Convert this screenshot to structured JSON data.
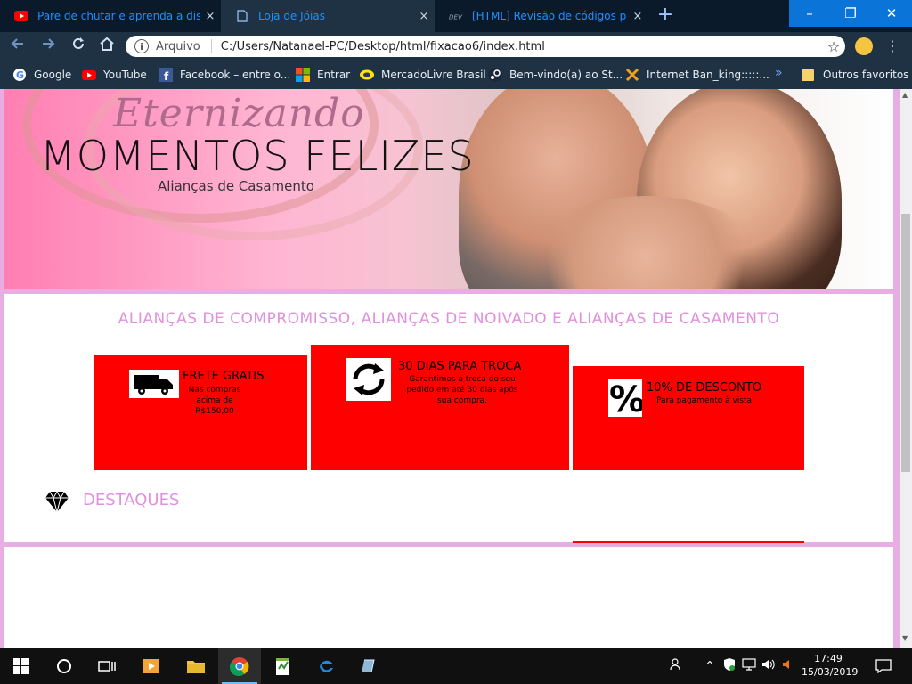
{
  "browser": {
    "tabs": [
      {
        "title": "Pare de chutar e aprenda a displa",
        "icon": "youtube-icon",
        "active": false
      },
      {
        "title": "Loja de Jóias",
        "icon": "page-icon",
        "active": true
      },
      {
        "title": "[HTML] Revisão de códigos para",
        "icon": "forum-icon",
        "active": false
      }
    ],
    "tab_close_glyph": "×",
    "new_tab_glyph": "+",
    "window_controls": {
      "minimize": "–",
      "restore": "❐",
      "close": "✕"
    },
    "address": {
      "security_label": "Arquivo",
      "url": "C:/Users/Natanael-PC/Desktop/html/fixacao6/index.html"
    },
    "bookmarks": [
      {
        "label": "Google",
        "icon": "google-icon"
      },
      {
        "label": "YouTube",
        "icon": "youtube-icon"
      },
      {
        "label": "Facebook – entre o...",
        "icon": "facebook-icon"
      },
      {
        "label": "Entrar",
        "icon": "microsoft-icon"
      },
      {
        "label": "MercadoLivre Brasil",
        "icon": "mercadolivre-icon"
      },
      {
        "label": "Bem-vindo(a) ao St...",
        "icon": "steam-icon"
      },
      {
        "label": "Internet Ban_king:::::...",
        "icon": "bank-icon"
      }
    ],
    "more_bookmarks_glyph": "»",
    "other_favorites": "Outros favoritos"
  },
  "page": {
    "banner": {
      "script_title": "Eternizando",
      "main_title": "MOMENTOS FELIZES",
      "subtitle": "Alianças de Casamento"
    },
    "headline": "ALIANÇAS DE COMPROMISSO, ALIANÇAS DE NOIVADO E ALIANÇAS DE CASAMENTO",
    "cards": [
      {
        "title": "FRETE GRATIS",
        "description": "Nas compras acima de R$150,00",
        "icon": "truck-icon"
      },
      {
        "title": "30 DIAS PARA TROCA",
        "description": "Garantimos a troca do seu pedido em até 30 dias após sua compra.",
        "icon": "refresh-icon"
      },
      {
        "title": "10% DE DESCONTO",
        "description": "Para pagamento à vista.",
        "icon": "percent-icon"
      }
    ],
    "section_title": "DESTAQUES",
    "colors": {
      "accent": "#e090dd",
      "card": "#ff0000",
      "border": "#e8aee4"
    }
  },
  "taskbar": {
    "apps": [
      "windows-start-icon",
      "cortana-icon",
      "task-view-icon",
      "media-player-icon",
      "file-explorer-icon",
      "chrome-icon",
      "notepadpp-icon",
      "edge-icon",
      "app-icon"
    ],
    "clock_time": "17:49",
    "clock_date": "15/03/2019"
  }
}
